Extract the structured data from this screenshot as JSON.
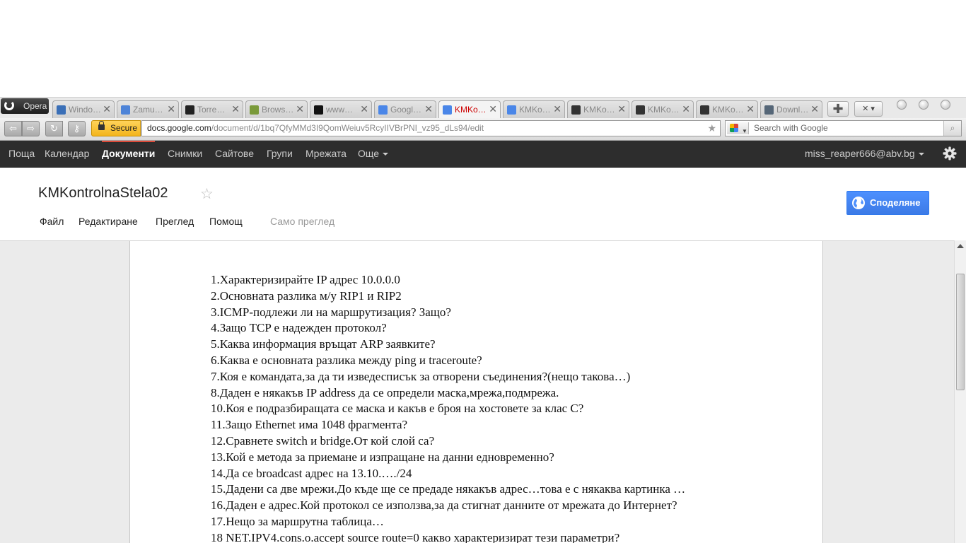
{
  "browser": {
    "opera_label": "Opera",
    "tabs": [
      {
        "label": "Windo…",
        "icon": "windows-icon",
        "color": "#3a6fb7"
      },
      {
        "label": "Zamu…",
        "icon": "user-icon",
        "color": "#4e84d8"
      },
      {
        "label": "Torre…",
        "icon": "torrent-icon",
        "color": "#222222"
      },
      {
        "label": "Brows…",
        "icon": "browser-icon",
        "color": "#7a9a3a"
      },
      {
        "label": "www…",
        "icon": "pirate-icon",
        "color": "#111111"
      },
      {
        "label": "Googl…",
        "icon": "document-icon",
        "color": "#4a86e8"
      },
      {
        "label": "KMKo…",
        "icon": "document-icon",
        "color": "#4a86e8",
        "active": true
      },
      {
        "label": "KMKo…",
        "icon": "document-icon",
        "color": "#4a86e8"
      },
      {
        "label": "KMKo…",
        "icon": "image-icon",
        "color": "#333333"
      },
      {
        "label": "KMKo…",
        "icon": "image-icon",
        "color": "#333333"
      },
      {
        "label": "KMKo…",
        "icon": "image-icon",
        "color": "#333333"
      },
      {
        "label": "Downl…",
        "icon": "download-icon",
        "color": "#556677"
      }
    ],
    "secure_label": "Secure",
    "url_host": "docs.google.com",
    "url_path": "/document/d/1bq7QfyMMd3I9QomWeiuv5RcyIIVBrPNI_vz95_dLs94/edit",
    "search_placeholder": "Search with Google"
  },
  "gbar": {
    "items": [
      "Поща",
      "Календар",
      "Документи",
      "Снимки",
      "Сайтове",
      "Групи",
      "Мрежата",
      "Още"
    ],
    "active": "Документи",
    "account": "miss_reaper666@abv.bg"
  },
  "doc": {
    "title": "KMKontrolnaStela02",
    "menu": [
      "Файл",
      "Редактиране",
      "Преглед",
      "Помощ"
    ],
    "view_only": "Само преглед",
    "share_label": "Споделяне",
    "lines": [
      "1.Характеризирайте IP адрес 10.0.0.0",
      "2.Основната разлика м/у RIP1 и RIP2",
      "3.ICMP-подлежи ли на маршрутизация? Защо?",
      "4.Защо TCP е надежден протокол?",
      "5.Каква информация връщат ARP заявките?",
      "6.Каква е основната разлика между ping и traceroute?",
      "7.Коя е командата,за да ти изведесписък за отворени съединения?(нещо такова…)",
      "8.Даден е някакъв IP address да се определи маска,мрежа,подмрежа.",
      "10.Коя е подразбиращата се маска и какъв е броя на хостовете за клас С?",
      "11.Защо Ethernet има 1048 фрагмента?",
      "12.Сравнете switch и bridge.От кой слой са?",
      "13.Кой е метода за приемане и изпращане на данни едновременно?",
      "14.Да се broadcast адрес на 13.10.…./24",
      "15.Дадени са две мрежи.До къде ще се предаде някакъв адрес…това е с някаква картинка …",
      "16.Даден е адрес.Кой протокол се използва,за да стигнат данните от мрежата до Интернет?",
      "17.Нещо за маршрутна таблица…",
      "18 NET.IPV4.cons.o.accept  source  route=0 какво характеризират тези параметри?"
    ]
  },
  "colors": {
    "gbar_bg": "#2d2d2d",
    "gbar_active_accent": "#dd4b39",
    "share_button": "#4d90fe",
    "secure_badge": "#f3b51b"
  }
}
